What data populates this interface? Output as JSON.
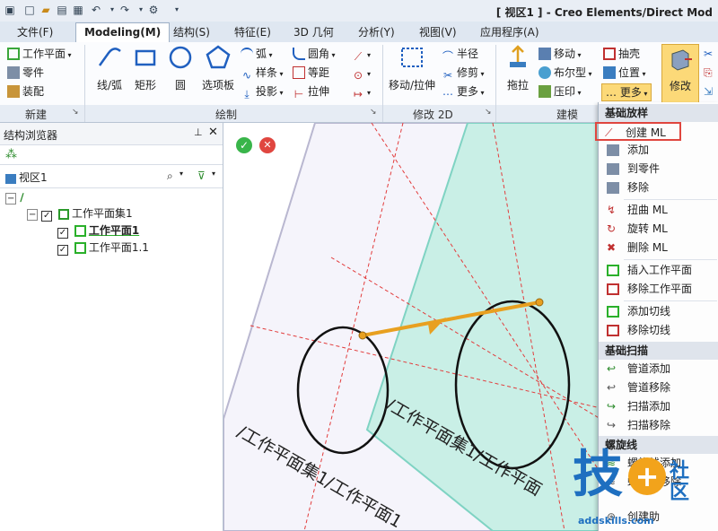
{
  "window": {
    "title": "[ 视区1 ] - Creo Elements/Direct Mod"
  },
  "tabs": [
    {
      "label": "文件(F)"
    },
    {
      "label": "Modeling(M)"
    },
    {
      "label": "结构(S)"
    },
    {
      "label": "特征(E)"
    },
    {
      "label": "3D 几何"
    },
    {
      "label": "分析(Y)"
    },
    {
      "label": "视图(V)"
    },
    {
      "label": "应用程序(A)"
    }
  ],
  "ribbon": {
    "new_group": {
      "workplane": "工作平面",
      "part": "零件",
      "assembly": "装配"
    },
    "draw_group": {
      "line_arc": "线/弧",
      "rect": "矩形",
      "circle": "圆",
      "options": "选项板",
      "arc": "弧",
      "spline": "样条",
      "projection": "投影",
      "fillet": "圆角",
      "offset": "等距",
      "extend": "拉伸"
    },
    "modify2d_group": {
      "move_extrude": "移动/拉伸",
      "radius": "半径",
      "trim": "修剪",
      "more": "更多"
    },
    "model_group": {
      "pull": "拖拉",
      "move": "移动",
      "boolean": "布尔型",
      "imprint": "压印",
      "shell": "抽壳",
      "position": "位置",
      "more": "… 更多",
      "modify": "修改"
    },
    "group_labels": {
      "new": "新建",
      "draw": "绘制",
      "modify2d": "修改 2D",
      "model": "建模"
    }
  },
  "browser": {
    "title": "结构浏览器",
    "view": "视区1",
    "tree": {
      "set": "工作平面集1",
      "wp1": "工作平面1",
      "wp2": "工作平面1.1"
    }
  },
  "viewport": {
    "label_1": "/工作平面集1/工作平面1",
    "label_2": "/工作平面集1/工作平面"
  },
  "menu": {
    "sections": [
      {
        "title": "基础放样"
      },
      {
        "title": "基础扫描"
      },
      {
        "title": "螺旋线"
      }
    ],
    "loft_items": [
      "创建 ML",
      "添加",
      "到零件",
      "移除",
      "扭曲 ML",
      "旋转 ML",
      "删除 ML",
      "插入工作平面",
      "移除工作平面",
      "添加切线",
      "移除切线"
    ],
    "sweep_items": [
      "管道添加",
      "管道移除",
      "扫描添加",
      "扫描移除"
    ],
    "helix_items": [
      "螺旋线添加",
      "螺旋线移除",
      "创建助"
    ]
  },
  "watermark": {
    "brand": "技",
    "community": "社区",
    "url": "addskills.com"
  },
  "colors": {
    "accent": "#e0463f",
    "plane_green": "#8fe0d0",
    "arrow": "#e8a020"
  }
}
